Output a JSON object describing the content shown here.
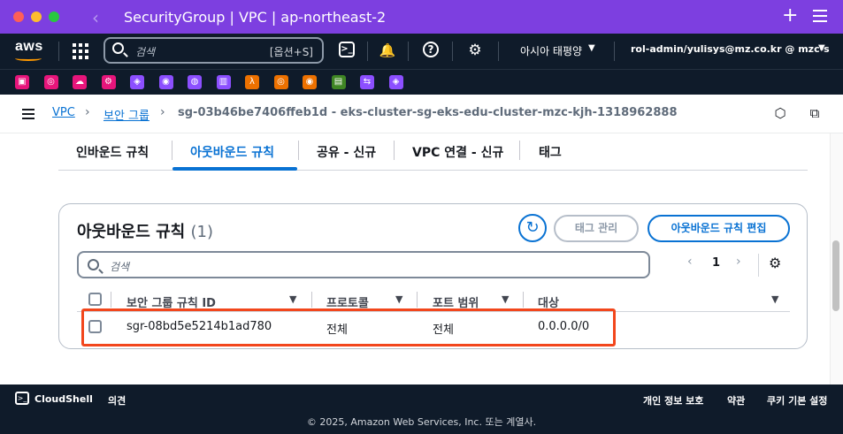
{
  "window": {
    "title": "SecurityGroup | VPC | ap-northeast-2",
    "back_glyph": "‹",
    "plus_glyph": "+"
  },
  "topnav": {
    "logo": "aws",
    "search_placeholder": "검색",
    "search_shortcut": "[옵션+S]",
    "cloudshell_glyph": ">_",
    "bell_glyph": "🔔",
    "help_glyph": "?",
    "settings_glyph": "⚙",
    "region": "아시아 태평양",
    "region_caret": "▼",
    "account": "rol-admin/yulisys@mz.co.kr @ mzc-s",
    "account_caret": "▼"
  },
  "favorites": [
    {
      "icon": "ec2-icon",
      "color": "#e7157b"
    },
    {
      "icon": "cloudwatch-icon",
      "color": "#e7157b"
    },
    {
      "icon": "cloud-icon",
      "color": "#e7157b"
    },
    {
      "icon": "config-icon",
      "color": "#e7157b"
    },
    {
      "icon": "iam-icon",
      "color": "#8c4fff"
    },
    {
      "icon": "security-hub-icon",
      "color": "#8c4fff"
    },
    {
      "icon": "route53-icon",
      "color": "#8c4fff"
    },
    {
      "icon": "vpc-icon",
      "color": "#8c4fff"
    },
    {
      "icon": "lambda-icon",
      "color": "#ed7100"
    },
    {
      "icon": "ecs-icon",
      "color": "#ed7100"
    },
    {
      "icon": "eks-icon",
      "color": "#ed7100"
    },
    {
      "icon": "s3-icon",
      "color": "#3f8624"
    },
    {
      "icon": "api-gateway-icon",
      "color": "#8c4fff"
    },
    {
      "icon": "appsync-icon",
      "color": "#8c4fff"
    }
  ],
  "breadcrumb": {
    "items": [
      "VPC",
      "보안 그룹"
    ],
    "current": "sg-03b46be7406ffeb1d - eks-cluster-sg-eks-edu-cluster-mzc-kjh-1318962888",
    "separator": "›"
  },
  "tabs": [
    {
      "label": "인바운드 규칙",
      "active": false
    },
    {
      "label": "아웃바운드 규칙",
      "active": true
    },
    {
      "label": "공유 - 신규",
      "active": false
    },
    {
      "label": "VPC 연결 - 신규",
      "active": false
    },
    {
      "label": "태그",
      "active": false
    }
  ],
  "panel": {
    "title": "아웃바운드 규칙",
    "count": "(1)",
    "refresh_glyph": "↻",
    "manage_tags_label": "태그 관리",
    "edit_rules_label": "아웃바운드 규칙 편집",
    "filter_placeholder": "검색",
    "pagination": {
      "prev": "‹",
      "page": "1",
      "next": "›"
    },
    "settings_glyph": "⚙",
    "columns": [
      "보안 그룹 규칙 ID",
      "프로토콜",
      "포트 범위",
      "대상"
    ],
    "sort_glyph": "▼",
    "rows": [
      [
        "sgr-08bd5e5214b1ad780",
        "전체",
        "전체",
        "0.0.0.0/0"
      ]
    ]
  },
  "footer": {
    "cloudshell": "CloudShell",
    "feedback": "의견",
    "privacy": "개인 정보 보호",
    "terms": "약관",
    "cookies": "쿠키 기본 설정",
    "copyright": "© 2025, Amazon Web Services, Inc. 또는 계열사."
  },
  "colors": {
    "title_bar": "#7d3fe0",
    "nav_bg": "#0f1b2a",
    "accent": "#0972d3",
    "highlight_box": "#f2461c"
  }
}
